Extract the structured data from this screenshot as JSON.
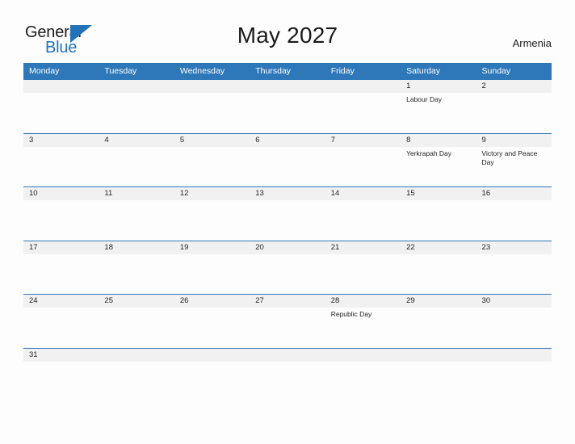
{
  "brand": {
    "name_part1": "General",
    "name_part2": "Blue",
    "accent_color": "#2272b8"
  },
  "header": {
    "title": "May 2027",
    "country": "Armenia"
  },
  "calendar": {
    "header_color": "#2e77b8",
    "date_band_color": "#f1f1f1",
    "weekdays": [
      "Monday",
      "Tuesday",
      "Wednesday",
      "Thursday",
      "Friday",
      "Saturday",
      "Sunday"
    ],
    "weeks": [
      {
        "dates": [
          "",
          "",
          "",
          "",
          "",
          "1",
          "2"
        ],
        "events": [
          "",
          "",
          "",
          "",
          "",
          "Labour Day",
          ""
        ]
      },
      {
        "dates": [
          "3",
          "4",
          "5",
          "6",
          "7",
          "8",
          "9"
        ],
        "events": [
          "",
          "",
          "",
          "",
          "",
          "Yerkrapah Day",
          "Victory and Peace Day"
        ]
      },
      {
        "dates": [
          "10",
          "11",
          "12",
          "13",
          "14",
          "15",
          "16"
        ],
        "events": [
          "",
          "",
          "",
          "",
          "",
          "",
          ""
        ]
      },
      {
        "dates": [
          "17",
          "18",
          "19",
          "20",
          "21",
          "22",
          "23"
        ],
        "events": [
          "",
          "",
          "",
          "",
          "",
          "",
          ""
        ]
      },
      {
        "dates": [
          "24",
          "25",
          "26",
          "27",
          "28",
          "29",
          "30"
        ],
        "events": [
          "",
          "",
          "",
          "",
          "Republic Day",
          "",
          ""
        ]
      },
      {
        "dates": [
          "31",
          "",
          "",
          "",
          "",
          "",
          ""
        ],
        "events": [
          "",
          "",
          "",
          "",
          "",
          "",
          ""
        ]
      }
    ]
  }
}
